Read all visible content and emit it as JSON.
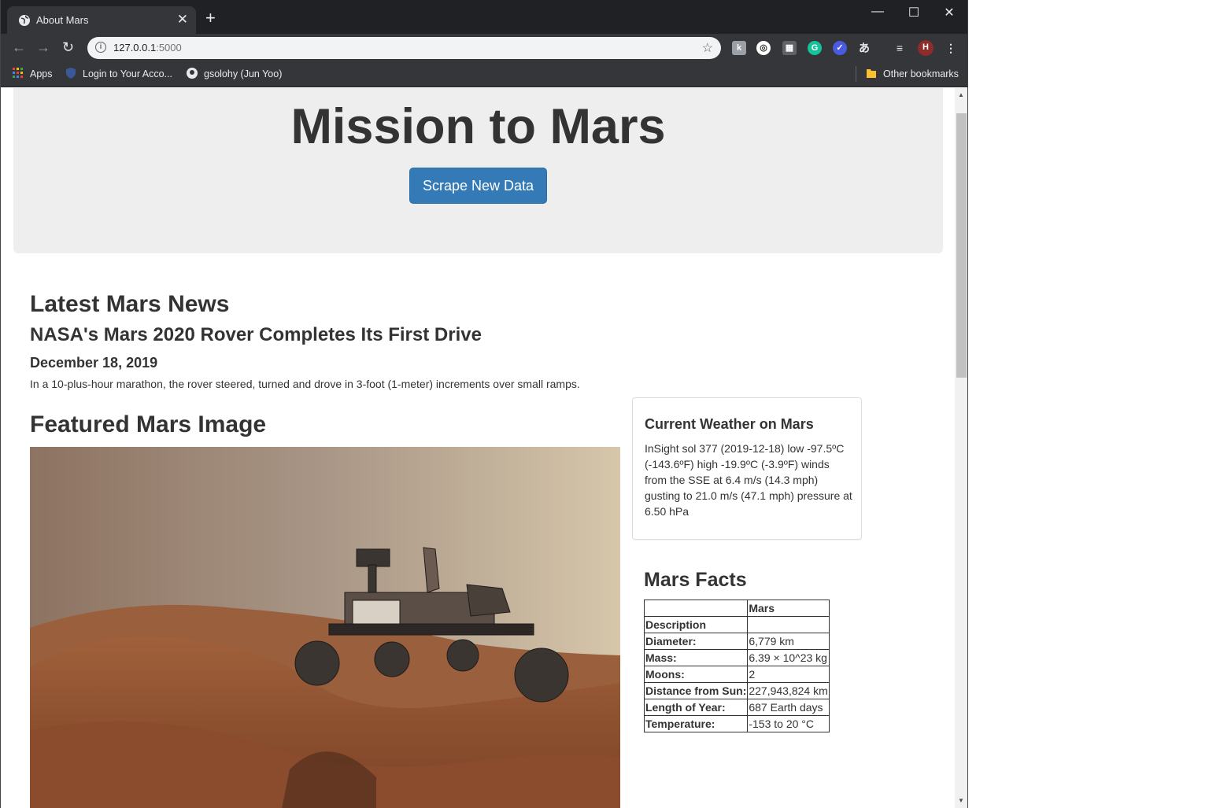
{
  "browser": {
    "tab_title": "About Mars",
    "url_host": "127.0.0.1",
    "url_port": ":5000",
    "bookmarks": {
      "apps": "Apps",
      "login": "Login to Your Acco...",
      "github": "gsolohy (Jun Yoo)",
      "other": "Other bookmarks"
    },
    "profile_initial": "H"
  },
  "page": {
    "title": "Mission to Mars",
    "scrape_button": "Scrape New Data",
    "news": {
      "heading": "Latest Mars News",
      "title": "NASA's Mars 2020 Rover Completes Its First Drive",
      "date": "December 18, 2019",
      "paragraph": "In a 10-plus-hour marathon, the rover steered, turned and drove in 3-foot (1-meter) increments over small ramps."
    },
    "featured": {
      "heading": "Featured Mars Image"
    },
    "weather": {
      "heading": "Current Weather on Mars",
      "text": "InSight sol 377 (2019-12-18) low -97.5ºC (-143.6ºF) high -19.9ºC (-3.9ºF) winds from the SSE at 6.4 m/s (14.3 mph) gusting to 21.0 m/s (47.1 mph) pressure at 6.50 hPa"
    },
    "facts": {
      "heading": "Mars Facts",
      "col_header": "Mars",
      "index_header": "Description",
      "rows": [
        {
          "k": "Diameter:",
          "v": "6,779 km"
        },
        {
          "k": "Mass:",
          "v": "6.39 × 10^23 kg"
        },
        {
          "k": "Moons:",
          "v": "2"
        },
        {
          "k": "Distance from Sun:",
          "v": "227,943,824 km"
        },
        {
          "k": "Length of Year:",
          "v": "687 Earth days"
        },
        {
          "k": "Temperature:",
          "v": "-153 to 20 °C"
        }
      ]
    }
  }
}
